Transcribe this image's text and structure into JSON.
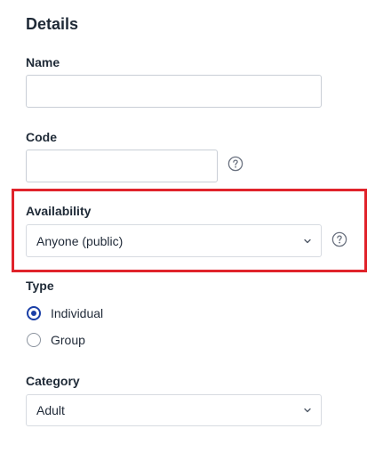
{
  "details": {
    "title": "Details"
  },
  "name_field": {
    "label": "Name",
    "value": "",
    "placeholder": ""
  },
  "code_field": {
    "label": "Code",
    "value": "",
    "placeholder": ""
  },
  "availability": {
    "label": "Availability",
    "selected": "Anyone (public)"
  },
  "type": {
    "label": "Type",
    "options": [
      {
        "label": "Individual",
        "checked": true
      },
      {
        "label": "Group",
        "checked": false
      }
    ]
  },
  "category": {
    "label": "Category",
    "selected": "Adult"
  },
  "colors": {
    "highlight": "#e0232b",
    "radio_accent": "#1a3fa6"
  },
  "icons": {
    "help": "question-circle-icon",
    "dropdown": "chevron-down-icon"
  }
}
